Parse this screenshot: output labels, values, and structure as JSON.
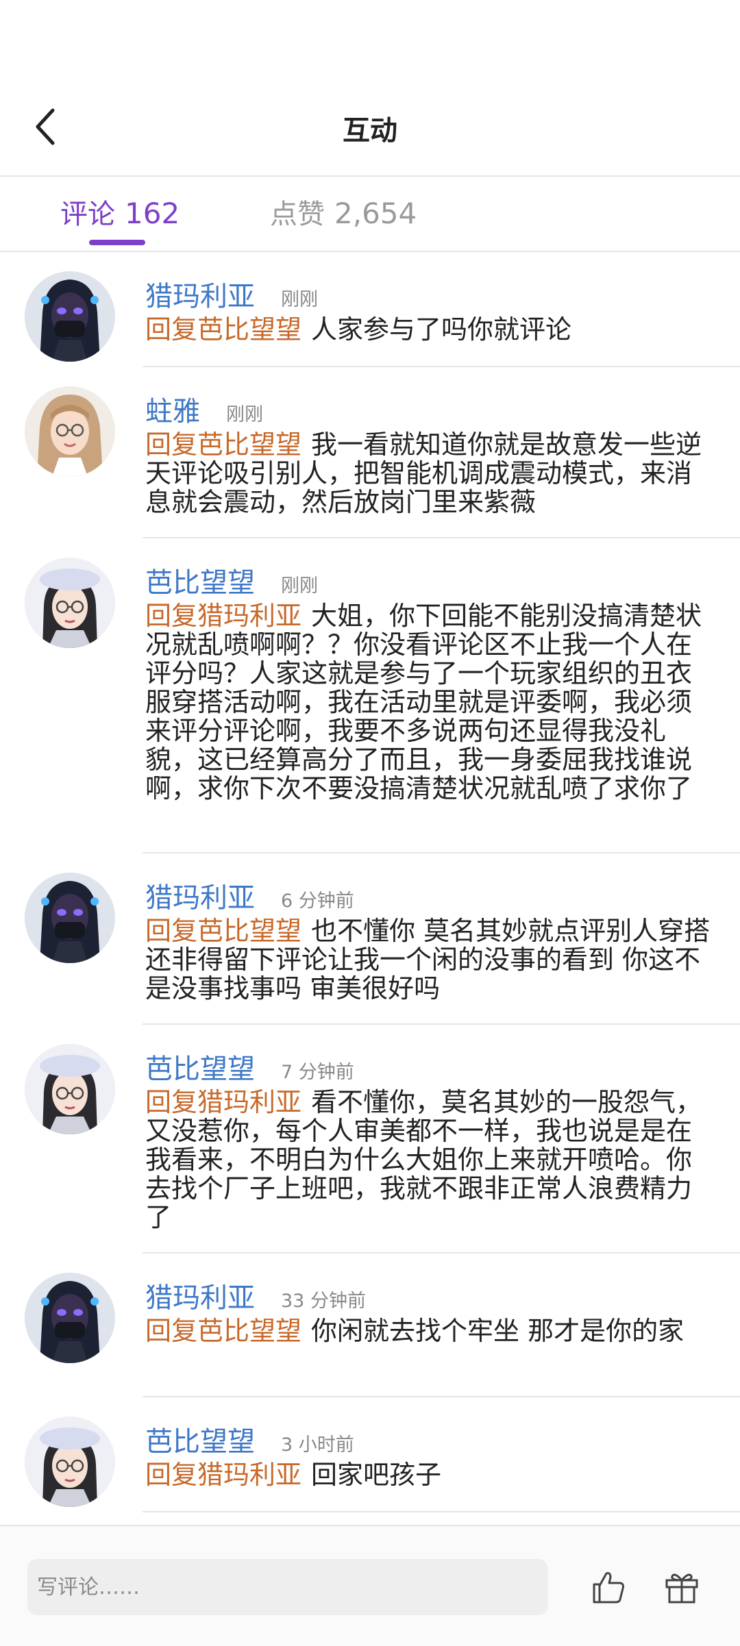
{
  "header": {
    "title": "互动",
    "back_icon": "chevron-left-icon"
  },
  "tabs": [
    {
      "label": "评论",
      "count": "162",
      "active": true
    },
    {
      "label": "点赞",
      "count": "2,654",
      "active": false
    }
  ],
  "comments": [
    {
      "user": "猎玛利亚",
      "time": "刚刚",
      "reply_to": "回复芭比望望",
      "text": "人家参与了吗你就评论",
      "avatar": "dark-masked-avatar"
    },
    {
      "user": "蛀雅",
      "time": "刚刚",
      "reply_to": "回复芭比望望",
      "text": "我一看就知道你就是故意发一些逆天评论吸引别人，把智能机调成震动模式，来消息就会震动，然后放岗门里来紫薇",
      "avatar": "blonde-glasses-avatar"
    },
    {
      "user": "芭比望望",
      "time": "刚刚",
      "reply_to": "回复猎玛利亚",
      "text": "大姐，你下回能不能别没搞清楚状况就乱喷啊啊？？你没看评论区不止我一个人在评分吗？人家这就是参与了一个玩家组织的丑衣服穿搭活动啊，我在活动里就是评委啊，我必须来评分评论啊，我要不多说两句还显得我没礼貌，这已经算高分了而且，我一身委屈我找谁说啊，求你下次不要没搞清楚状况就乱喷了求你了",
      "avatar": "beret-glasses-avatar"
    },
    {
      "user": "猎玛利亚",
      "time": "6 分钟前",
      "reply_to": "回复芭比望望",
      "text": "也不懂你 莫名其妙就点评别人穿搭 还非得留下评论让我一个闲的没事的看到 你这不是没事找事吗 审美很好吗",
      "avatar": "dark-masked-avatar"
    },
    {
      "user": "芭比望望",
      "time": "7 分钟前",
      "reply_to": "回复猎玛利亚",
      "text": "看不懂你，莫名其妙的一股怨气，又没惹你，每个人审美都不一样，我也说是是在我看来，不明白为什么大姐你上来就开喷哈。你去找个厂子上班吧，我就不跟非正常人浪费精力了",
      "avatar": "beret-glasses-avatar"
    },
    {
      "user": "猎玛利亚",
      "time": "33 分钟前",
      "reply_to": "回复芭比望望",
      "text": "你闲就去找个牢坐 那才是你的家",
      "avatar": "dark-masked-avatar"
    },
    {
      "user": "芭比望望",
      "time": "3 小时前",
      "reply_to": "回复猎玛利亚",
      "text": "回家吧孩子",
      "avatar": "beret-glasses-avatar"
    }
  ],
  "bottom_bar": {
    "input_placeholder": "写评论……",
    "like_icon": "thumbs-up-icon",
    "gift_icon": "gift-icon"
  },
  "colors": {
    "accent": "#7d3fc9",
    "username": "#3f78c8",
    "reply_tag": "#c8692a",
    "muted": "#9a9a9a"
  }
}
